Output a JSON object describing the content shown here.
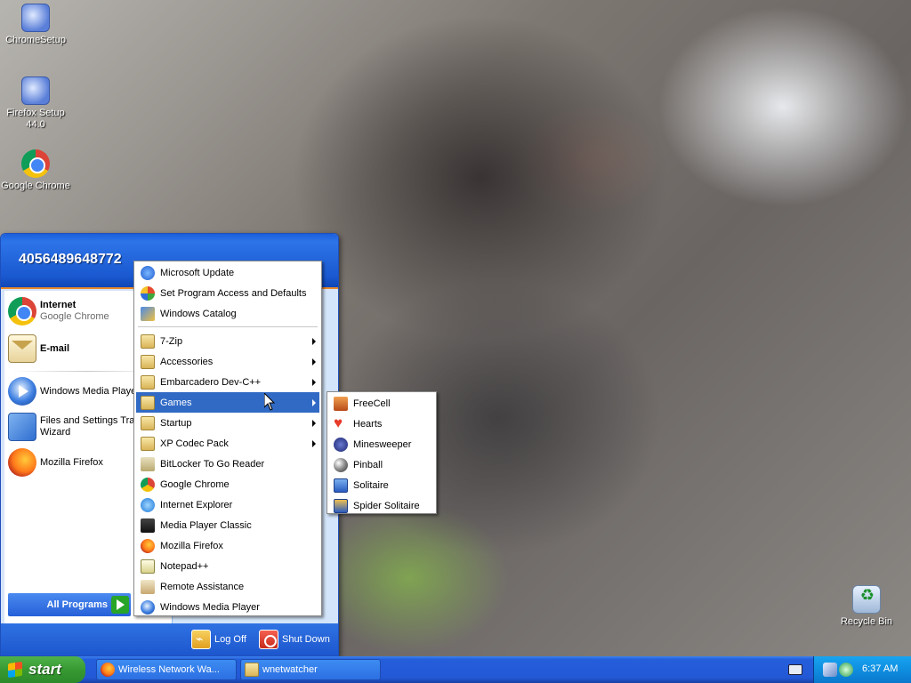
{
  "desktop": {
    "icons": [
      {
        "label": "ChromeSetup",
        "icon": "installer-icon"
      },
      {
        "label": "Firefox Setup 44.0",
        "icon": "installer-icon"
      },
      {
        "label": "Google Chrome",
        "icon": "chrome-icon"
      },
      {
        "label": "Recycle Bin",
        "icon": "recycle-bin-icon"
      }
    ]
  },
  "start_menu": {
    "user_name": "4056489648772",
    "pinned": [
      {
        "title": "Internet",
        "subtitle": "Google Chrome",
        "icon": "chrome-icon"
      },
      {
        "title": "E-mail",
        "subtitle": "",
        "icon": "mail-icon"
      }
    ],
    "recent": [
      {
        "label": "Windows Media Player",
        "icon": "media-player-icon"
      },
      {
        "label": "Files and Settings Transfer Wizard",
        "icon": "transfer-wizard-icon"
      },
      {
        "label": "Mozilla Firefox",
        "icon": "firefox-icon"
      }
    ],
    "all_programs_label": "All Programs",
    "log_off_label": "Log Off",
    "shut_down_label": "Shut Down"
  },
  "programs_menu": {
    "top_items": [
      {
        "label": "Microsoft Update",
        "icon": "windows-update-icon"
      },
      {
        "label": "Set Program Access and Defaults",
        "icon": "program-defaults-icon"
      },
      {
        "label": "Windows Catalog",
        "icon": "windows-catalog-icon"
      }
    ],
    "items": [
      {
        "label": "7-Zip",
        "icon": "folder-icon",
        "submenu": true
      },
      {
        "label": "Accessories",
        "icon": "folder-icon",
        "submenu": true
      },
      {
        "label": "Embarcadero Dev-C++",
        "icon": "folder-icon",
        "submenu": true
      },
      {
        "label": "Games",
        "icon": "folder-icon",
        "submenu": true,
        "highlighted": true
      },
      {
        "label": "Startup",
        "icon": "folder-icon",
        "submenu": true
      },
      {
        "label": "XP Codec Pack",
        "icon": "folder-icon",
        "submenu": true
      },
      {
        "label": "BitLocker To Go Reader",
        "icon": "bitlocker-icon",
        "submenu": false
      },
      {
        "label": "Google Chrome",
        "icon": "chrome-icon",
        "submenu": false
      },
      {
        "label": "Internet Explorer",
        "icon": "internet-explorer-icon",
        "submenu": false
      },
      {
        "label": "Media Player Classic",
        "icon": "media-player-classic-icon",
        "submenu": false
      },
      {
        "label": "Mozilla Firefox",
        "icon": "firefox-icon",
        "submenu": false
      },
      {
        "label": "Notepad++",
        "icon": "notepad-icon",
        "submenu": false
      },
      {
        "label": "Remote Assistance",
        "icon": "remote-assistance-icon",
        "submenu": false
      },
      {
        "label": "Windows Media Player",
        "icon": "media-player-icon",
        "submenu": false
      }
    ]
  },
  "games_menu": {
    "items": [
      {
        "label": "FreeCell",
        "icon": "freecell-icon"
      },
      {
        "label": "Hearts",
        "icon": "hearts-icon"
      },
      {
        "label": "Minesweeper",
        "icon": "minesweeper-icon"
      },
      {
        "label": "Pinball",
        "icon": "pinball-icon"
      },
      {
        "label": "Solitaire",
        "icon": "solitaire-icon"
      },
      {
        "label": "Spider Solitaire",
        "icon": "spider-solitaire-icon"
      }
    ]
  },
  "taskbar": {
    "start_label": "start",
    "tasks": [
      {
        "label": "Wireless Network Wa...",
        "icon": "firefox-icon"
      },
      {
        "label": "wnetwatcher",
        "icon": "folder-icon"
      }
    ],
    "clock": "6:37 AM"
  },
  "colors": {
    "taskbar_blue": "#245edb",
    "start_green": "#379a32",
    "menu_highlight": "#316ac5",
    "tray_blue": "#0f8ee0"
  }
}
